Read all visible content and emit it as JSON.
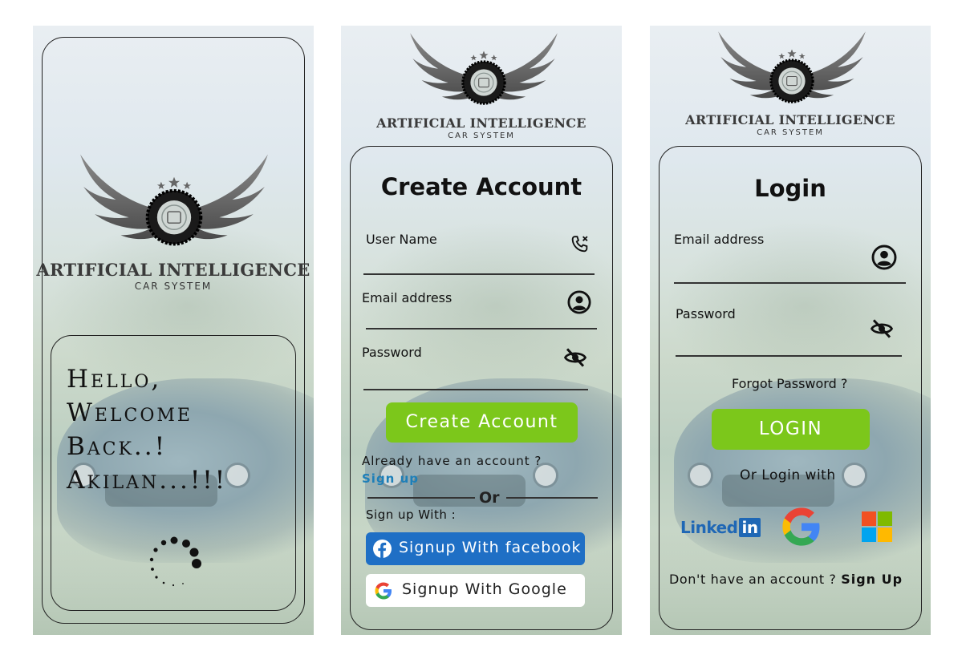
{
  "brand": {
    "title": "ARTIFICIAL INTELLIGENCE",
    "subtitle": "CAR SYSTEM",
    "badge": "AI"
  },
  "splash": {
    "greeting_line1": "Hello,",
    "greeting_line2": "Welcome",
    "greeting_line3": "Back..!",
    "greeting_line4": "Akilan...!!!"
  },
  "signup": {
    "heading": "Create Account",
    "username_label": "User Name",
    "email_label": "Email address",
    "password_label": "Password",
    "submit_label": "Create Account",
    "have_account_text": "Already have an account ?",
    "signin_link": "Sign up",
    "or_text": "Or",
    "signup_with_text": "Sign up With :",
    "facebook_label": "Signup With facebook",
    "google_label": "Signup With Google"
  },
  "login": {
    "heading": "Login",
    "email_label": "Email address",
    "password_label": "Password",
    "forgot_label": "Forgot Password ?",
    "submit_label": "LOGIN",
    "or_login_with": "Or Login with",
    "linkedin_text": "Linked",
    "linkedin_in": "in",
    "no_account_text": "Don't have an account ?",
    "signup_link": "Sign Up"
  },
  "colors": {
    "accent_green": "#7cc71b",
    "facebook_blue": "#1f6fc5",
    "link_blue": "#1e7fb8",
    "linkedin_blue": "#1f67b5"
  },
  "icons": {
    "username": "phone-icon",
    "email": "user-circle-icon",
    "password": "eye-off-icon",
    "facebook": "facebook-icon",
    "google": "google-icon",
    "microsoft": "microsoft-icon"
  }
}
